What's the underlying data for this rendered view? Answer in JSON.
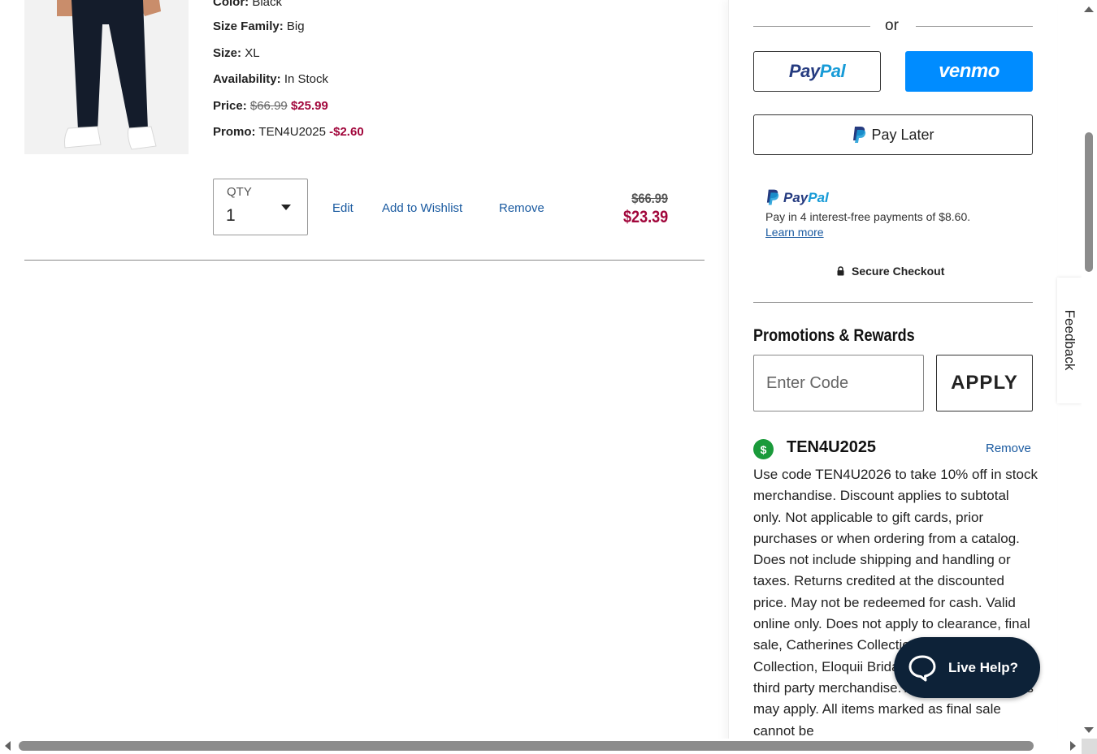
{
  "item": {
    "image_alt": "pants-product-image",
    "color_label": "Color:",
    "color_value": "Black",
    "size_family_label": "Size Family:",
    "size_family_value": "Big",
    "size_label": "Size:",
    "size_value": "XL",
    "availability_label": "Availability:",
    "availability_value": "In Stock",
    "price_label": "Price:",
    "price_original": "$66.99",
    "price_sale": "$25.99",
    "promo_label": "Promo:",
    "promo_code": "TEN4U2025",
    "promo_discount": "-$2.60",
    "qty_label": "QTY",
    "qty_value": "1",
    "edit_label": "Edit",
    "wishlist_label": "Add to Wishlist",
    "remove_label": "Remove",
    "total_original": "$66.99",
    "total_final": "$23.39"
  },
  "summary": {
    "or_text": "or",
    "paypal_pay": "Pay",
    "paypal_pal": "Pal",
    "venmo_label": "venmo",
    "pay_later_label": "Pay Later",
    "pp_msg_pay": "Pay",
    "pp_msg_pal": "Pal",
    "pp_msg_text": "Pay in 4 interest-free payments of $8.60.",
    "pp_learn_more": "Learn more",
    "secure_checkout": "Secure Checkout",
    "promotions_title": "Promotions & Rewards",
    "code_placeholder": "Enter Code",
    "apply_label": "APPLY",
    "applied_badge": "$",
    "applied_code": "TEN4U2025",
    "applied_remove": "Remove",
    "applied_description": "Use code TEN4U2026 to take 10% off in stock merchandise. Discount applies to subtotal only. Not applicable to gift cards, prior purchases or when ordering from a catalog. Does not include shipping and handling or taxes. Returns credited at the discounted price. May not be redeemed for cash. Valid online only. Does not apply to clearance, final sale, Catherines Collection, June & Vie Collection, Eloquii Bridal, One Day Sale, or third party merchandise. Additional exclusions may apply. All items marked as final sale cannot be"
  },
  "widgets": {
    "feedback_label": "Feedback",
    "live_help_label": "Live Help?"
  },
  "colors": {
    "sale_red": "#a1063b",
    "link_blue": "#1a5aa0",
    "venmo_blue": "#008cff",
    "paypal_dark": "#253b80",
    "paypal_light": "#179bd7",
    "live_help_bg": "#0d2238",
    "promo_badge_green": "#1a9a3a"
  },
  "icons": {
    "lock": "lock-icon",
    "chat": "chat-bubble-icon",
    "caret": "chevron-down-icon",
    "paypal": "paypal-p-icon"
  }
}
